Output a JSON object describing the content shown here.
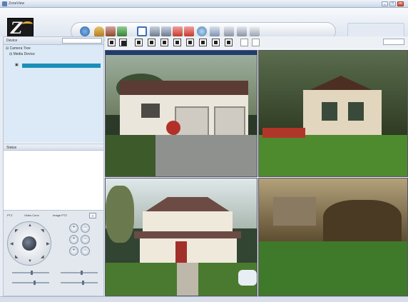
{
  "window": {
    "title": "ZoneView",
    "controls": [
      "_",
      "□",
      "×"
    ]
  },
  "header": {
    "logo_letter": "Z",
    "status_lines": [
      "",
      ""
    ]
  },
  "left_panel": {
    "device_header_label": "Device",
    "device_select_value": "",
    "tree": {
      "root_label": "Camera Tree",
      "child_label": "Media Device",
      "selected_label": ""
    },
    "status_header_label": "Status",
    "ptz": {
      "tabs": [
        "PTZ",
        "Video Conv.",
        "Image PTZ",
        "≡"
      ],
      "zoom_buttons": [
        "+",
        "−",
        "+",
        "−",
        "+",
        "−"
      ]
    }
  },
  "video": {
    "layout_select_value": "",
    "cameras": [
      {
        "label": ""
      },
      {
        "label": ""
      },
      {
        "label": ""
      },
      {
        "label": ""
      }
    ]
  },
  "colors": {
    "selection": "#1b8fb8",
    "tree_bg": "#dbeaf6",
    "camera_titlebar": "#1f3c6e"
  }
}
